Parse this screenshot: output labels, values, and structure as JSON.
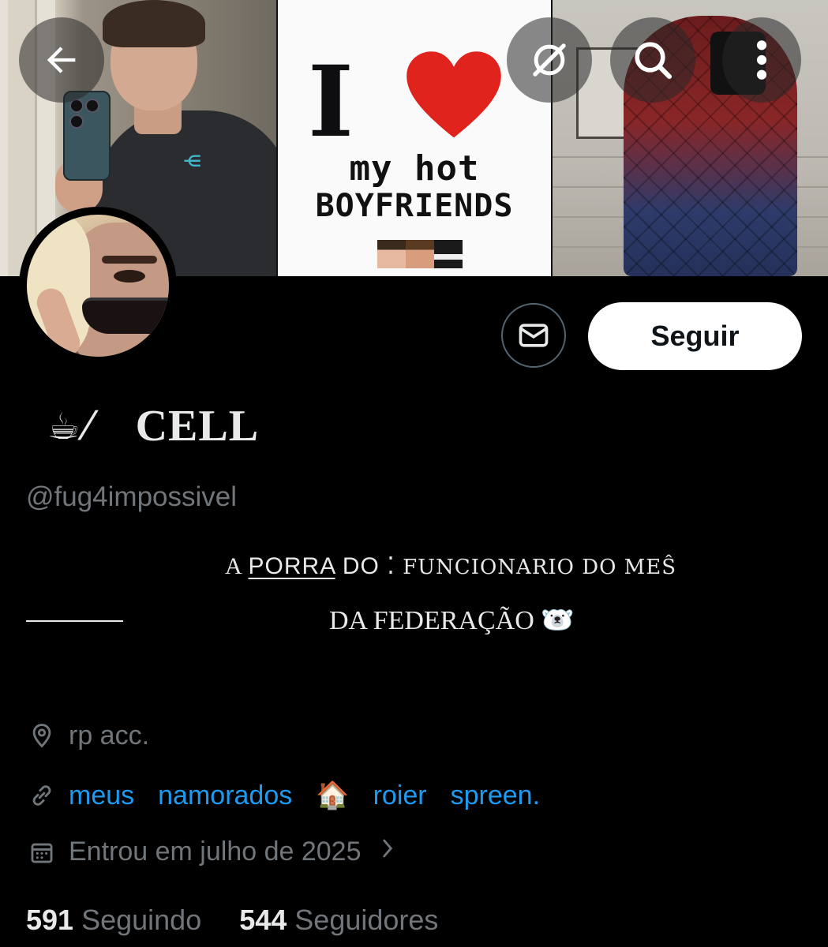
{
  "header": {
    "back_icon": "arrow-left-icon",
    "grok_icon": "grok-icon",
    "search_icon": "search-icon",
    "more_icon": "more-vertical-icon"
  },
  "banner": {
    "middle_image": {
      "big_letter": "I",
      "line1": "my hot",
      "line2": "BOYFRIENDS"
    }
  },
  "actions": {
    "message_icon": "envelope-icon",
    "follow_label": "Seguir"
  },
  "profile": {
    "name_emoji": "☕",
    "name_slash": "⁄",
    "name": "CELL",
    "handle": "@fug4impossivel",
    "bio": {
      "line1_a": "A ",
      "line1_porra": "PORRA",
      "line1_do": " DO",
      "line1_mark": " ⁚ ",
      "line1_rest": "FUNCIONARIO DO MEŜ",
      "line2": "DA FEDERAÇÃO 🐻‍❄️"
    },
    "location": "rp acc.",
    "links": [
      "meus",
      "namorados",
      "roier",
      "spreen."
    ],
    "link_emoji": "🏠",
    "joined": "Entrou em julho de 2025"
  },
  "stats": {
    "following_count": "591",
    "following_label": "Seguindo",
    "followers_count": "544",
    "followers_label": "Seguidores"
  },
  "colors": {
    "background": "#000000",
    "text": "#e7e9ea",
    "muted": "#71767b",
    "link": "#1d9bf0",
    "follow_button_bg": "#ffffff"
  }
}
